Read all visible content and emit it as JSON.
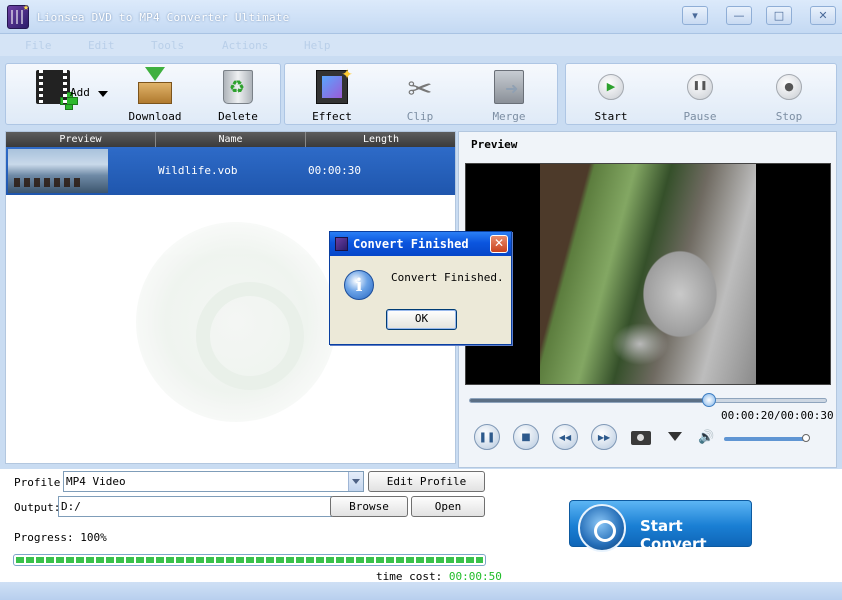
{
  "window": {
    "title": "Lionsea DVD to MP4 Converter Ultimate",
    "controls": [
      "▾",
      "—",
      "□",
      "✕"
    ]
  },
  "menu": [
    "File",
    "Edit",
    "Tools",
    "Actions",
    "Help"
  ],
  "toolbar": {
    "add_label": "Add",
    "download_label": "Download",
    "delete_label": "Delete",
    "effect_label": "Effect",
    "clip_label": "Clip",
    "merge_label": "Merge",
    "start_label": "Start",
    "pause_label": "Pause",
    "stop_label": "Stop",
    "play_glyph": "▶",
    "pause_glyph": "❚❚",
    "stop_glyph": "●"
  },
  "file_list": {
    "columns": [
      "Preview",
      "Name",
      "Length"
    ],
    "rows": [
      {
        "name": "Wildlife.vob",
        "length": "00:00:30"
      }
    ]
  },
  "preview": {
    "label": "Preview",
    "time": "00:00:20/00:00:30",
    "position": 0.67,
    "volume": 1.0,
    "buttons": {
      "pause": "❚❚",
      "stop": "■",
      "rewind": "◀◀",
      "forward": "▶▶"
    }
  },
  "settings": {
    "profile_label": "Profile:",
    "profile_value": "MP4 Video",
    "edit_profile": "Edit Profile",
    "output_label": "Output:",
    "output_value": "D:/",
    "browse": "Browse",
    "open": "Open",
    "progress_text": "Progress: 100%",
    "progress": 1.0,
    "time_cost_label": "time cost:",
    "time_cost_value": "00:00:50"
  },
  "start_convert": "Start Convert",
  "dialog": {
    "title": "Convert Finished",
    "message": "Convert Finished.",
    "ok": "OK",
    "info_glyph": "i",
    "close_glyph": "✕"
  },
  "colors": {
    "accent": "#1f56ad",
    "progress": "#38c24a",
    "time_cost": "#1fbc28"
  }
}
